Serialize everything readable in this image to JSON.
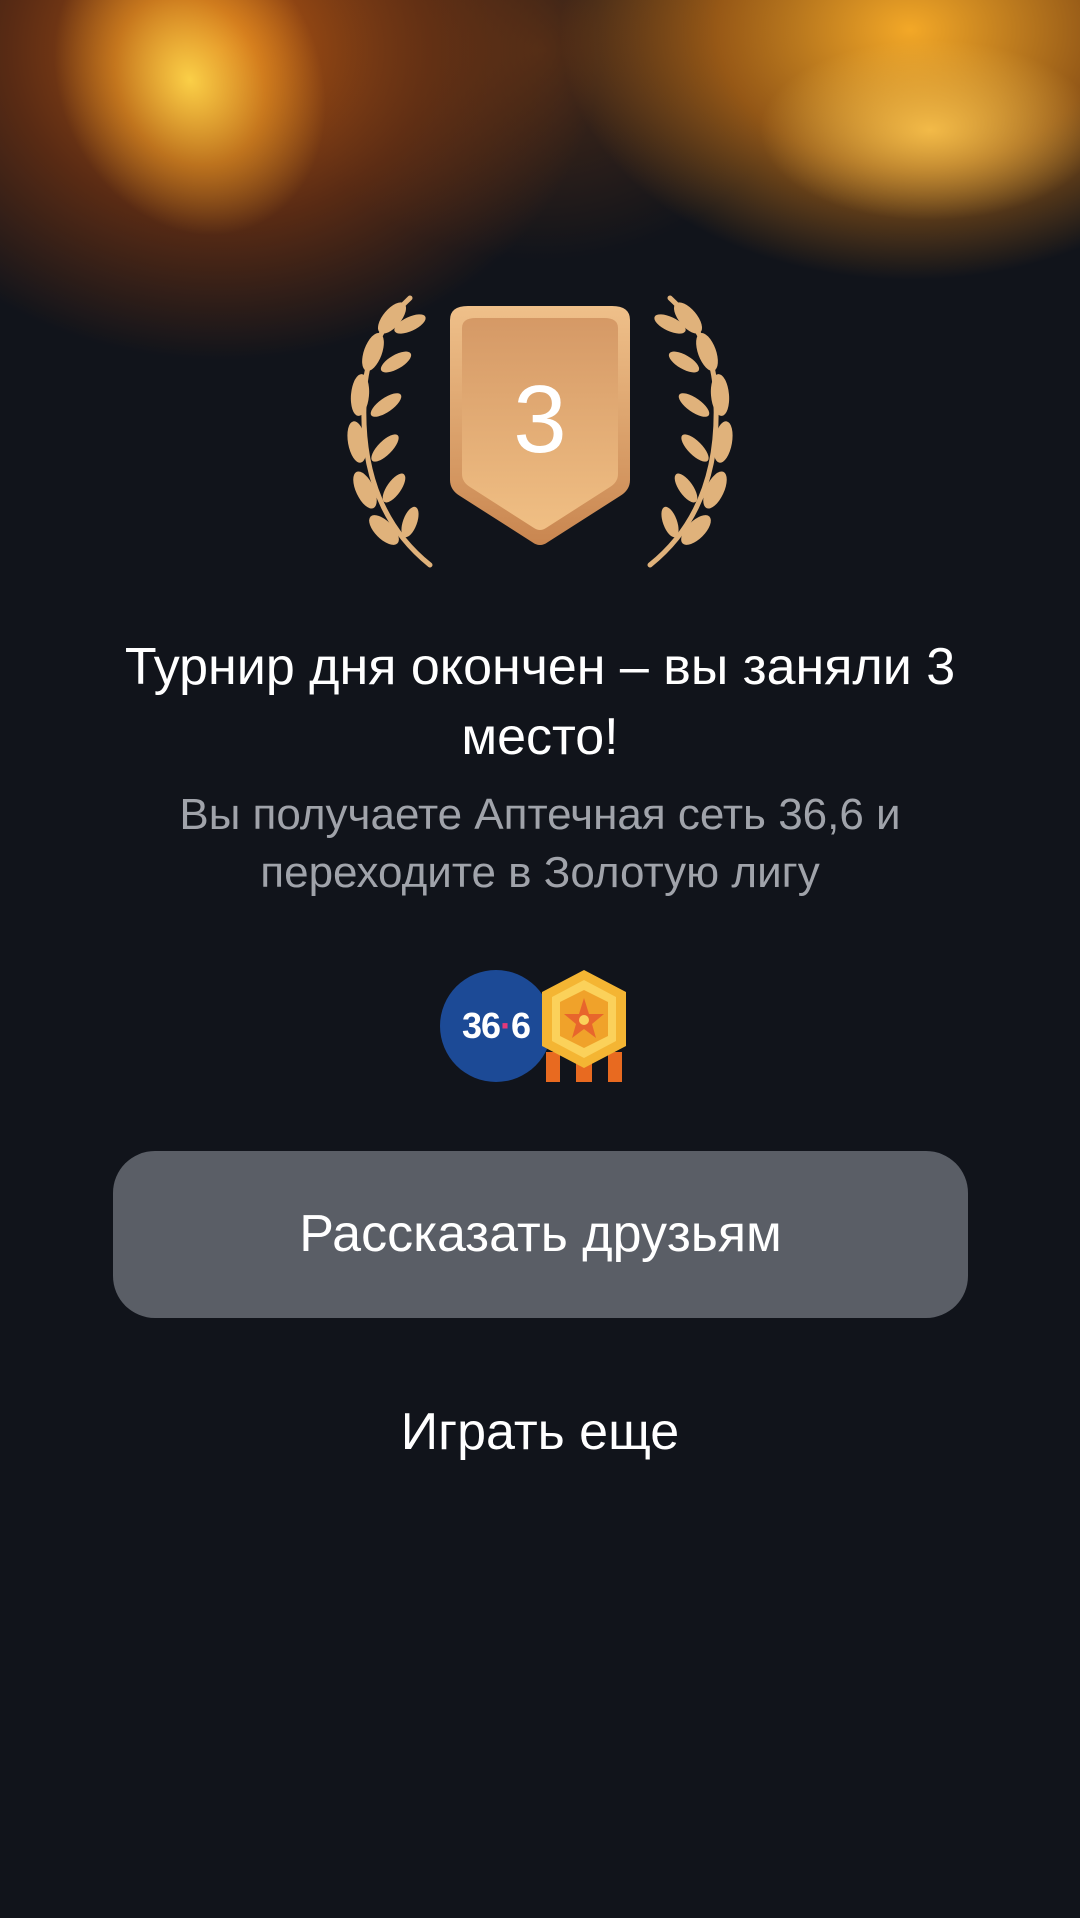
{
  "award": {
    "place": "3",
    "colors": {
      "shield_top": "#d59966",
      "shield_bottom": "#f0bf84",
      "laurel": "#e0b27b"
    }
  },
  "result": {
    "title": "Турнир дня окончен – вы заняли 3 место!",
    "subtitle": "Вы получаете Аптечная сеть 36,6 и переходите в Золотую лигу"
  },
  "rewards": {
    "partner_logo": {
      "text_a": "36",
      "dot": "·",
      "text_b": "6",
      "color": "#1c4a96"
    },
    "league_badge_icon": "gold-league-badge-icon"
  },
  "actions": {
    "share_label": "Рассказать друзьям",
    "play_again_label": "Играть еще"
  }
}
